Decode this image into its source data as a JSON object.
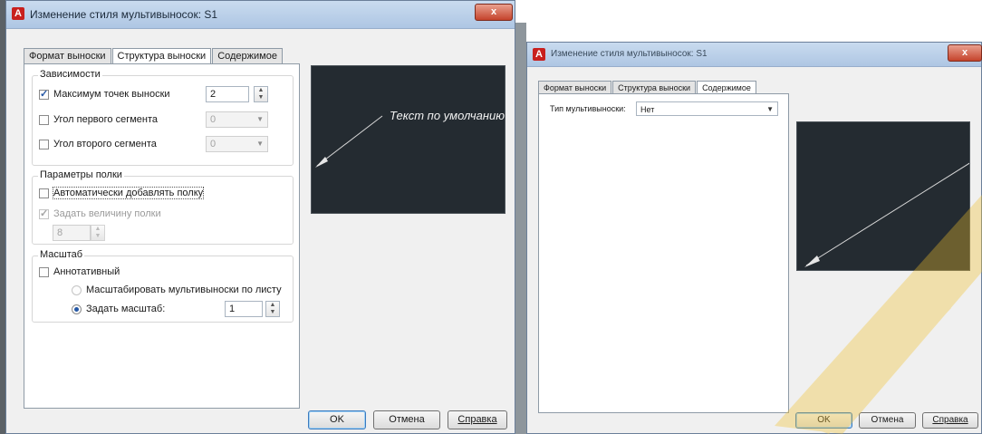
{
  "left_dialog": {
    "title": "Изменение стиля мультивыносок: S1",
    "close_label": "x",
    "tabs": [
      "Формат выноски",
      "Структура выноски",
      "Содержимое"
    ],
    "active_tab": "Структура выноски",
    "dependencies": {
      "group_label": "Зависимости",
      "max_points_label": "Максимум точек выноски",
      "max_points_checked": true,
      "max_points_value": "2",
      "first_segment_label": "Угол первого сегмента",
      "first_segment_checked": false,
      "first_segment_value": "0",
      "second_segment_label": "Угол второго сегмента",
      "second_segment_checked": false,
      "second_segment_value": "0"
    },
    "landing": {
      "group_label": "Параметры полки",
      "auto_landing_label": "Автоматически добавлять полку",
      "auto_landing_checked": false,
      "set_distance_label": "Задать величину полки",
      "set_distance_checked": true,
      "distance_value": "8"
    },
    "scale": {
      "group_label": "Масштаб",
      "annotative_label": "Аннотативный",
      "annotative_checked": false,
      "scale_to_layout_label": "Масштабировать мультивыноски по листу",
      "specify_scale_label": "Задать масштаб:",
      "specify_scale_selected": true,
      "scale_value": "1"
    },
    "preview_text": "Текст по умолчанию",
    "buttons": {
      "ok": "OK",
      "cancel": "Отмена",
      "help": "Справка"
    }
  },
  "right_dialog": {
    "title": "Изменение стиля мультивыносок: S1",
    "close_label": "x",
    "tabs": [
      "Формат выноски",
      "Структура выноски",
      "Содержимое"
    ],
    "active_tab": "Содержимое",
    "multileader_type_label": "Тип мультивыноски:",
    "multileader_type_value": "Нет",
    "buttons": {
      "ok": "OK",
      "cancel": "Отмена",
      "help": "Справка"
    }
  },
  "colors": {
    "preview_bg": "#242b31",
    "titlebar": "#aec6e3",
    "checkbox_accent": "#2457a5",
    "app_logo": "#c8201e",
    "watermark": "#f2c12e"
  }
}
